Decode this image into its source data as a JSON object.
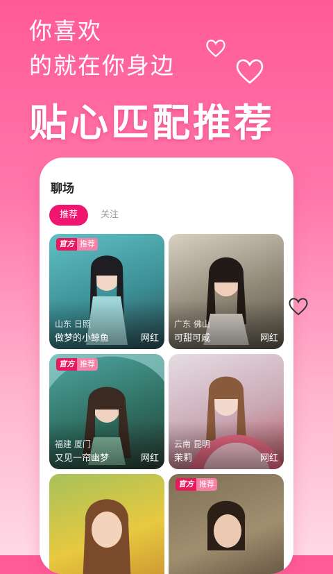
{
  "hero": {
    "line1": "你喜欢",
    "line2": "的就在你身边",
    "title": "贴心匹配推荐"
  },
  "screen": {
    "title": "聊场",
    "tabs": [
      {
        "label": "推荐",
        "active": true
      },
      {
        "label": "关注",
        "active": false
      }
    ]
  },
  "badge": {
    "part1": "官方",
    "part2": "推荐"
  },
  "cards": [
    {
      "location": "山东 日照",
      "name": "做梦的小鲸鱼",
      "tag": "网红",
      "official": true
    },
    {
      "location": "广东 佛山",
      "name": "可甜可咸",
      "tag": "网红",
      "official": false
    },
    {
      "location": "福建 厦门",
      "name": "又见一帘幽梦",
      "tag": "网红",
      "official": true
    },
    {
      "location": "云南 昆明",
      "name": "茉莉",
      "tag": "网红",
      "official": false
    },
    {
      "location": "",
      "name": "",
      "tag": "",
      "official": false
    },
    {
      "location": "",
      "name": "",
      "tag": "",
      "official": true
    }
  ],
  "colors": {
    "accent": "#f0156e",
    "background_top": "#ff5a96"
  }
}
